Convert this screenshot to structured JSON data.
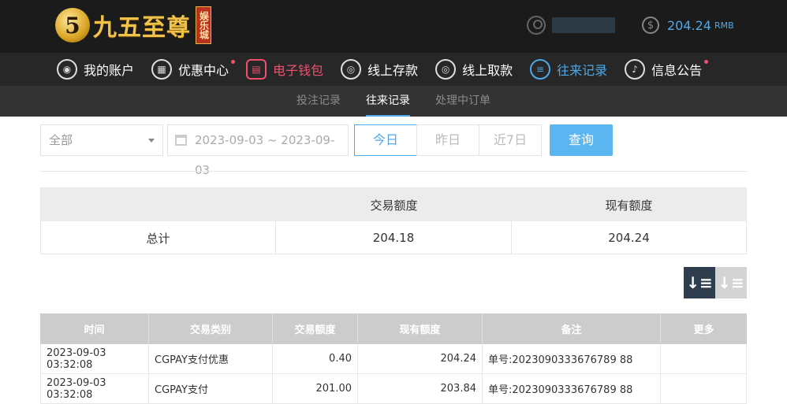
{
  "header": {
    "logo_mark": "5",
    "logo_text": "九五至尊",
    "logo_tag": "娱乐城",
    "balance": "204.24",
    "currency": "RMB"
  },
  "nav": [
    {
      "label": "我的账户",
      "icon": "user-icon",
      "state": "normal",
      "dot": false
    },
    {
      "label": "优惠中心",
      "icon": "gift-icon",
      "state": "normal",
      "dot": true
    },
    {
      "label": "电子钱包",
      "icon": "wallet-icon",
      "state": "red",
      "dot": false
    },
    {
      "label": "线上存款",
      "icon": "deposit-icon",
      "state": "normal",
      "dot": false
    },
    {
      "label": "线上取款",
      "icon": "withdraw-icon",
      "state": "normal",
      "dot": false
    },
    {
      "label": "往来记录",
      "icon": "records-icon",
      "state": "blue",
      "dot": false
    },
    {
      "label": "信息公告",
      "icon": "bell-icon",
      "state": "normal",
      "dot": true
    }
  ],
  "subnav": {
    "tabs": [
      "投注记录",
      "往来记录",
      "处理中订单"
    ],
    "active": "往来记录"
  },
  "filters": {
    "type_select": "全部",
    "date_range": "2023-09-03 ~ 2023-09-03",
    "today": "今日",
    "yesterday": "昨日",
    "last7": "近7日",
    "query": "查询"
  },
  "summary": {
    "headers": [
      "",
      "交易额度",
      "现有额度"
    ],
    "row": [
      "总计",
      "204.18",
      "204.24"
    ]
  },
  "records": {
    "headers": [
      "时间",
      "交易类别",
      "交易额度",
      "现有额度",
      "备注",
      "更多"
    ],
    "rows": [
      [
        "2023-09-03 03:32:08",
        "CGPAY支付优惠",
        "0.40",
        "204.24",
        "单号:2023090333676789 88",
        ""
      ],
      [
        "2023-09-03 03:32:08",
        "CGPAY支付",
        "201.00",
        "203.84",
        "单号:2023090333676789 88",
        ""
      ]
    ]
  },
  "colors": {
    "accent_blue": "#4ea8e8",
    "accent_red": "#f0506e",
    "header_bg": "#1b1b1b"
  }
}
